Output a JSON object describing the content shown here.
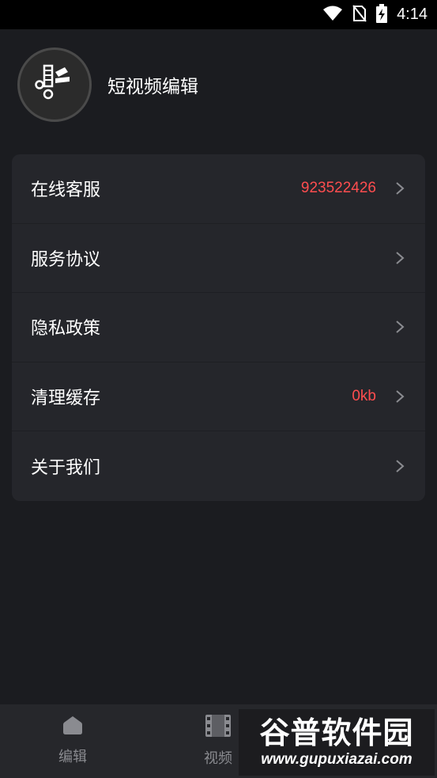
{
  "status_bar": {
    "time": "4:14",
    "icons": [
      "wifi-icon",
      "no-sim-icon",
      "battery-charging-icon"
    ]
  },
  "profile": {
    "title": "短视频编辑",
    "avatar_icon": "scissors-film-icon"
  },
  "menu": {
    "items": [
      {
        "label": "在线客服",
        "value": "923522426"
      },
      {
        "label": "服务协议",
        "value": ""
      },
      {
        "label": "隐私政策",
        "value": ""
      },
      {
        "label": "清理缓存",
        "value": "0kb"
      },
      {
        "label": "关于我们",
        "value": ""
      }
    ]
  },
  "bottom_nav": {
    "items": [
      {
        "label": "编辑",
        "icon": "home-icon"
      },
      {
        "label": "视频",
        "icon": "film-icon"
      }
    ]
  },
  "watermark": {
    "brand": "谷普软件园",
    "url": "www.gupuxiazai.com"
  },
  "colors": {
    "background": "#1b1c20",
    "card": "#25262b",
    "accent_value": "#ff4d4f",
    "nav_background": "#26272b",
    "nav_text": "#8a8b90"
  }
}
